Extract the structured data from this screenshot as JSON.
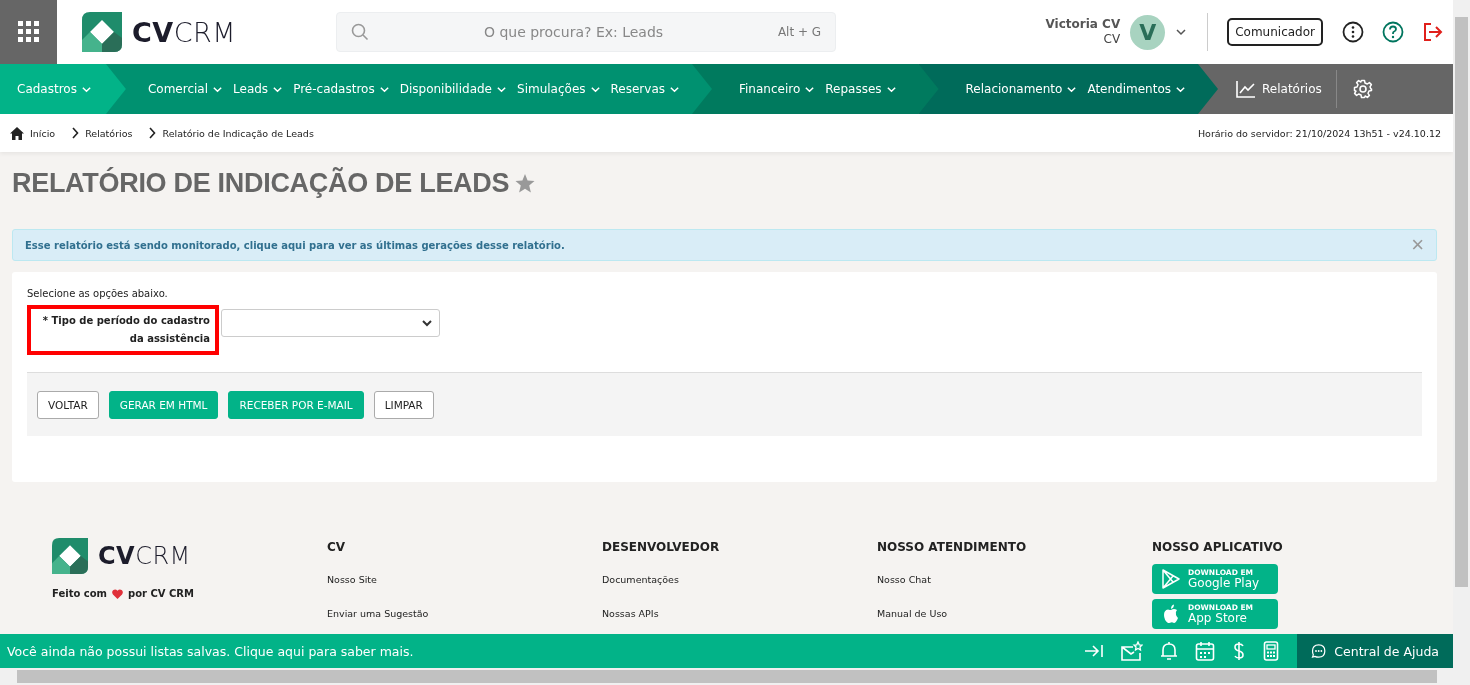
{
  "header": {
    "logo": {
      "bold": "CV",
      "light": "CRM"
    },
    "search": {
      "placeholder": "O que procura? Ex: Leads",
      "shortcut": "Alt + G"
    },
    "user": {
      "name": "Victoria CV",
      "company": "CV",
      "initial": "V"
    },
    "communicator_button": "Comunicador"
  },
  "nav": {
    "segments": [
      {
        "color": "#02b388",
        "items": [
          "Cadastros"
        ]
      },
      {
        "color": "#009170",
        "items": [
          "Comercial",
          "Leads",
          "Pré-cadastros",
          "Disponibilidade",
          "Simulações",
          "Reservas"
        ]
      },
      {
        "color": "#007a5e",
        "items": [
          "Financeiro",
          "Repasses"
        ]
      },
      {
        "color": "#006b5a",
        "items": [
          "Relacionamento",
          "Atendimentos"
        ]
      }
    ],
    "reports": "Relatórios"
  },
  "breadcrumb": [
    "Início",
    "Relatórios",
    "Relatório de Indicação de Leads"
  ],
  "server_time": "Horário do servidor: 21/10/2024 13h51 - v24.10.12",
  "page_title": "RELATÓRIO DE INDICAÇÃO DE LEADS",
  "favorite": false,
  "alert": {
    "text": "Esse relatório está sendo monitorado, clique aqui para ver as últimas gerações desse relatório.",
    "close": "×"
  },
  "form": {
    "intro": "Selecione as opções abaixo.",
    "fields": [
      {
        "label": "* Tipo de período do cadastro da assistência",
        "highlighted": true
      }
    ],
    "buttons": [
      {
        "label": "VOLTAR",
        "kind": "default"
      },
      {
        "label": "GERAR EM HTML",
        "kind": "primary"
      },
      {
        "label": "RECEBER POR E-MAIL",
        "kind": "primary"
      },
      {
        "label": "LIMPAR",
        "kind": "default"
      }
    ]
  },
  "footer": {
    "logo": {
      "bold": "CV",
      "light": "CRM"
    },
    "tagline": {
      "before": "Feito com",
      "after": "por CV CRM"
    },
    "columns": [
      {
        "title": "CV",
        "links": [
          "Nosso Site",
          "Enviar uma Sugestão"
        ]
      },
      {
        "title": "DESENVOLVEDOR",
        "links": [
          "Documentações",
          "Nossas APIs"
        ]
      },
      {
        "title": "NOSSO ATENDIMENTO",
        "links": [
          "Nosso Chat",
          "Manual de Uso"
        ]
      }
    ],
    "app_column": {
      "title": "NOSSO APLICATIVO",
      "stores": [
        {
          "kind": "google",
          "caption": "DOWNLOAD EM",
          "name": "Google Play"
        },
        {
          "kind": "apple",
          "caption": "DOWNLOAD EM",
          "name": "App Store"
        }
      ]
    }
  },
  "bottom_bar": {
    "message": "Você ainda não possui listas salvas. Clique aqui para saber mais.",
    "help": "Central de Ajuda"
  }
}
